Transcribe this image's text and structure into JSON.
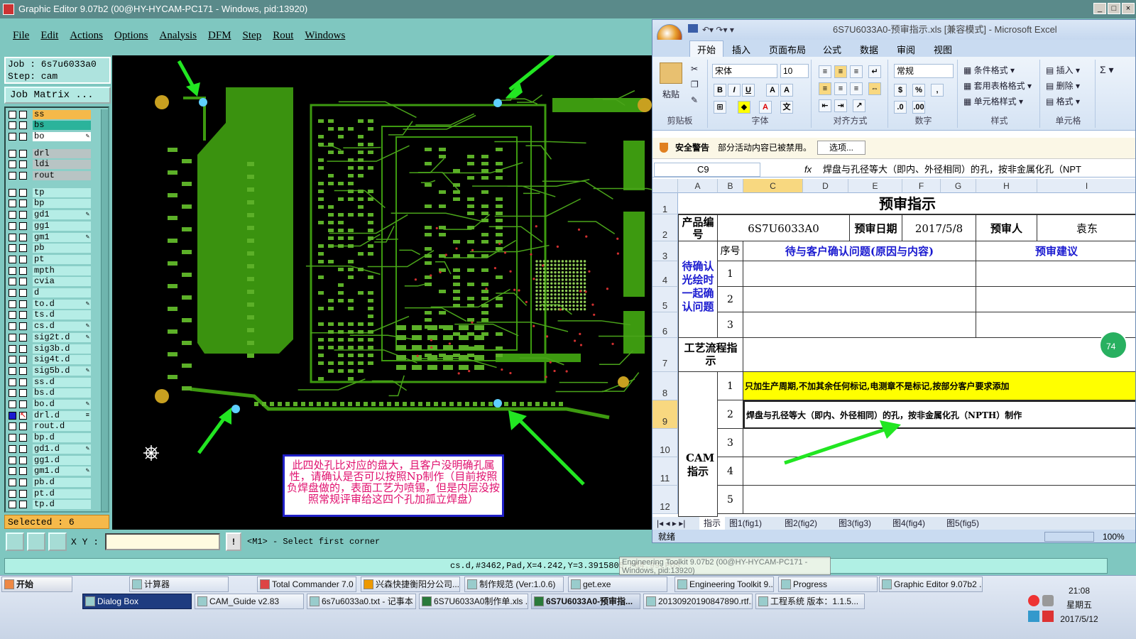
{
  "graphic_editor": {
    "title": "Graphic Editor 9.07b2 (00@HY-HYCAM-PC171 - Windows, pid:13920)",
    "menu": [
      "File",
      "Edit",
      "Actions",
      "Options",
      "Analysis",
      "DFM",
      "Step",
      "Rout",
      "Windows"
    ],
    "job_line": "Job : 6s7u6033a0",
    "step_line": "Step: cam",
    "job_matrix": "Job Matrix ...",
    "layers": [
      {
        "name": "ss",
        "color": "#f5b94a"
      },
      {
        "name": "bs",
        "color": "#2bb39b"
      },
      {
        "name": "bo",
        "color": "#ffffff",
        "edit": "✎"
      },
      {
        "name": "drl",
        "color": "#b8c4c4"
      },
      {
        "name": "ldi",
        "color": "#b8c4c4"
      },
      {
        "name": "rout",
        "color": "#b8c4c4"
      },
      {
        "name": "tp",
        "color": "#b5ede6"
      },
      {
        "name": "bp",
        "color": "#b5ede6"
      },
      {
        "name": "gd1",
        "color": "#b5ede6",
        "edit": "✎"
      },
      {
        "name": "gg1",
        "color": "#b5ede6"
      },
      {
        "name": "gm1",
        "color": "#b5ede6",
        "edit": "✎"
      },
      {
        "name": "pb",
        "color": "#b5ede6"
      },
      {
        "name": "pt",
        "color": "#b5ede6"
      },
      {
        "name": "mpth",
        "color": "#b5ede6"
      },
      {
        "name": "cvia",
        "color": "#b5ede6"
      },
      {
        "name": "d",
        "color": "#b5ede6"
      },
      {
        "name": "to.d",
        "color": "#b5ede6",
        "edit": "✎"
      },
      {
        "name": "ts.d",
        "color": "#b5ede6"
      },
      {
        "name": "cs.d",
        "color": "#b5ede6",
        "edit": "✎"
      },
      {
        "name": "sig2t.d",
        "color": "#b5ede6",
        "edit": "✎"
      },
      {
        "name": "sig3b.d",
        "color": "#b5ede6"
      },
      {
        "name": "sig4t.d",
        "color": "#b5ede6"
      },
      {
        "name": "sig5b.d",
        "color": "#b5ede6",
        "edit": "✎"
      },
      {
        "name": "ss.d",
        "color": "#b5ede6"
      },
      {
        "name": "bs.d",
        "color": "#b5ede6"
      },
      {
        "name": "bo.d",
        "color": "#b5ede6",
        "edit": "✎"
      },
      {
        "name": "drl.d",
        "color": "#b5ede6",
        "edit": "≡",
        "active": true
      },
      {
        "name": "rout.d",
        "color": "#b5ede6"
      },
      {
        "name": "bp.d",
        "color": "#b5ede6"
      },
      {
        "name": "gd1.d",
        "color": "#b5ede6",
        "edit": "✎"
      },
      {
        "name": "gg1.d",
        "color": "#b5ede6"
      },
      {
        "name": "gm1.d",
        "color": "#b5ede6",
        "edit": "✎"
      },
      {
        "name": "pb.d",
        "color": "#b5ede6"
      },
      {
        "name": "pt.d",
        "color": "#b5ede6"
      },
      {
        "name": "tp.d",
        "color": "#b5ede6"
      }
    ],
    "selected": "Selected : 6",
    "xy_label": "X Y :",
    "prompt": "<M1> - Select first corner",
    "status": "cs.d,#3462,Pad,X=4.242,Y=3.3915805,r64.99,POS",
    "tooltip": "Engineering Toolkit 9.07b2 (00@HY-HYCAM-PC171 - Windows, pid:13920)",
    "callout": "此四处孔比对应的盘大，且客户没明确孔属性，请确认是否可以按照Np制作（目前按照负焊盘做的，表面工艺为喷锡，但是内层没按照常规评审给这四个孔加孤立焊盘）"
  },
  "excel": {
    "title": "6S7U6033A0-预审指示.xls  [兼容模式] - Microsoft Excel",
    "tabs": [
      "开始",
      "插入",
      "页面布局",
      "公式",
      "数据",
      "审阅",
      "视图"
    ],
    "ribbon": {
      "paste": "粘贴",
      "font_name": "宋体",
      "font_size": "10",
      "number_format": "常规",
      "cond_format": "条件格式",
      "table_format": "套用表格格式",
      "cell_style": "单元格样式",
      "insert": "插入",
      "delete": "删除",
      "format": "格式",
      "groups": [
        "剪贴板",
        "字体",
        "对齐方式",
        "数字",
        "样式",
        "单元格"
      ]
    },
    "security_label": "安全警告",
    "security_msg": "部分活动内容已被禁用。",
    "security_btn": "选项...",
    "name_box": "C9",
    "formula": "焊盘与孔径等大（即内、外径相同）的孔，按非金属化孔（NPT",
    "columns": [
      "A",
      "B",
      "C",
      "D",
      "E",
      "F",
      "G",
      "H",
      "I"
    ],
    "rows": [
      "1",
      "2",
      "3",
      "4",
      "5",
      "6",
      "7",
      "8",
      "9",
      "10",
      "11",
      "12"
    ],
    "sheet": {
      "title": "预审指示",
      "product_label": "产品编号",
      "product_value": "6S7U6033A0",
      "date_label": "预审日期",
      "date_value": "2017/5/8",
      "reviewer_label": "预审人",
      "reviewer_value": "袁东",
      "seq_label": "序号",
      "issue_header": "待与客户确认问题(原因与内容)",
      "advice_header": "预审建议",
      "confirm_label": "待确认光绘时一起确认问题",
      "process_label": "工艺流程指示",
      "cam_label": "CAM指示",
      "nums": [
        "1",
        "2",
        "3",
        "1",
        "2",
        "3",
        "4",
        "5"
      ],
      "cam_row1": "只加生产周期,不加其余任何标记,电测章不是标记,按部分客户要求添加",
      "cam_row2": "焊盘与孔径等大（即内、外径相同）的孔，按非金属化孔（NPTH）制作"
    },
    "sheet_tabs": [
      "指示",
      "图1(fig1)",
      "图2(fig2)",
      "图3(fig3)",
      "图4(fig4)",
      "图5(fig5)"
    ],
    "status": "就绪",
    "zoom": "100%",
    "green_badge": "74"
  },
  "taskbar": {
    "start": "开始",
    "row1": [
      "计算器",
      "Total Commander 7.0 ...",
      "兴森快捷衡阳分公司...",
      "制作规范 (Ver:1.0.6)",
      "get.exe",
      "Engineering Toolkit 9....",
      "Progress",
      "Graphic Editor 9.07b2 ..."
    ],
    "row2": [
      "Dialog Box",
      "CAM_Guide v2.83",
      "6s7u6033a0.txt - 记事本",
      "6S7U6033A0制作单.xls ...",
      "6S7U6033A0-预审指...",
      "20130920190847890.rtf...",
      "工程系统  版本：1.1.5..."
    ],
    "time": "21:08",
    "weekday": "星期五",
    "date": "2017/5/12"
  },
  "colors": {
    "accent_green": "#22e622",
    "pcb_green": "#3d9a10",
    "highlight_yellow": "#ffff00",
    "title_blue": "#1a1ad0"
  }
}
